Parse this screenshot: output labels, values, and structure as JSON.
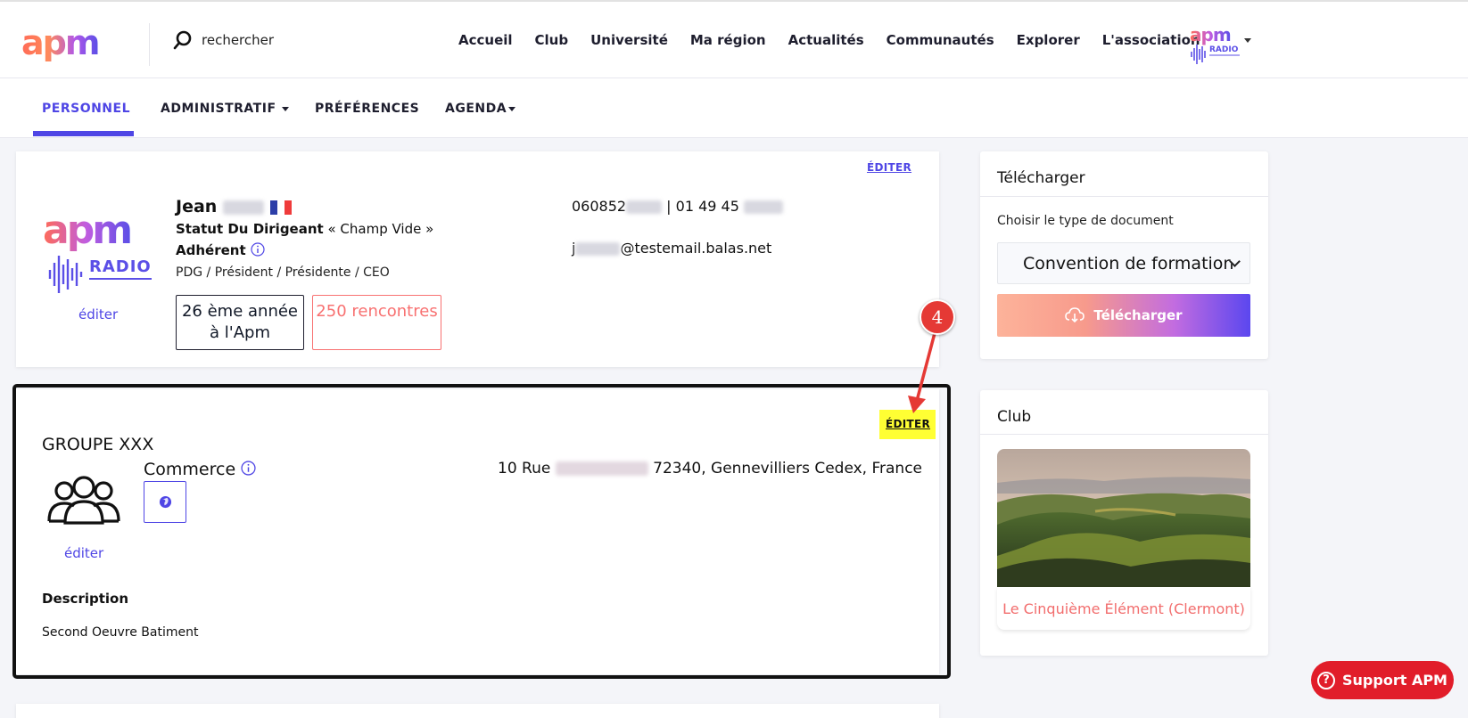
{
  "header": {
    "logo_text": "apm",
    "search_placeholder": "rechercher",
    "nav": [
      "Accueil",
      "Club",
      "Université",
      "Ma région",
      "Actualités",
      "Communautés",
      "Explorer",
      "L'association"
    ],
    "radio_logo_text": "RADIO"
  },
  "tabs": {
    "personnel": "PERSONNEL",
    "administratif": "ADMINISTRATIF",
    "preferences": "PRÉFÉRENCES",
    "agenda": "AGENDA"
  },
  "profile": {
    "edit_label": "ÉDITER",
    "first_name": "Jean",
    "status_label": "Statut Du Dirigeant",
    "status_value": "« Champ Vide »",
    "member_label": "Adhérent",
    "role": "PDG / Président / Présidente / CEO",
    "avatar_edit": "éditer",
    "years_box": "26 ème année à l'Apm",
    "meetings_box": "250 rencontres",
    "phone_mobile_prefix": "060852",
    "phone_sep": "| 01 49 45",
    "email_initial": "j",
    "email_domain": "@testemail.balas.net",
    "avatar_logo": "apm",
    "avatar_radio": "RADIO"
  },
  "company": {
    "edit_label": "ÉDITER",
    "name": "GROUPE XXX",
    "sector": "Commerce",
    "logo_edit": "éditer",
    "address_prefix": "10 Rue",
    "address_suffix": "72340, Gennevilliers Cedex, France",
    "description_title": "Description",
    "description": "Second Oeuvre Batiment"
  },
  "download": {
    "title": "Télécharger",
    "label": "Choisir le type de document",
    "selected": "Convention de formation",
    "button": "Télécharger"
  },
  "club": {
    "title": "Club",
    "name": "Le Cinquième Élément (Clermont)"
  },
  "support": {
    "label": "Support APM"
  },
  "annotation": {
    "step_number": "4"
  },
  "colors": {
    "accent": "#4f46e5",
    "coral": "#f87171",
    "support_red": "#e11d2a",
    "highlight": "#ffff33"
  }
}
